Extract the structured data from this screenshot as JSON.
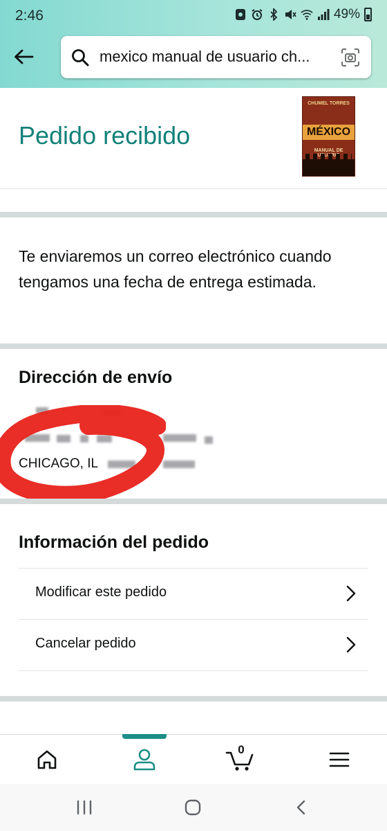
{
  "status_bar": {
    "time": "2:46",
    "battery": "49%"
  },
  "search": {
    "query": "mexico manual de usuario ch..."
  },
  "order": {
    "title": "Pedido recibido",
    "book_cover": {
      "author": "CHUMEL TORRES",
      "title": "MÉXICO",
      "subtitle": "MANUAL DE USUARIO"
    },
    "email_note": "Te enviaremos un correo electrónico cuando tengamos una fecha de entrega estimada."
  },
  "shipping": {
    "heading": "Dirección de envío",
    "city_line": "CHICAGO, IL"
  },
  "order_info": {
    "heading": "Información del pedido",
    "items": [
      {
        "label": "Modificar este pedido"
      },
      {
        "label": "Cancelar pedido"
      }
    ]
  },
  "bottom_nav": {
    "cart_count": "0",
    "active": "account"
  },
  "colors": {
    "accent": "#12817a",
    "header_start": "#83d9d1",
    "header_end": "#b9e9d9",
    "nav_active": "#1b8e86",
    "mark": "#e8221b"
  }
}
